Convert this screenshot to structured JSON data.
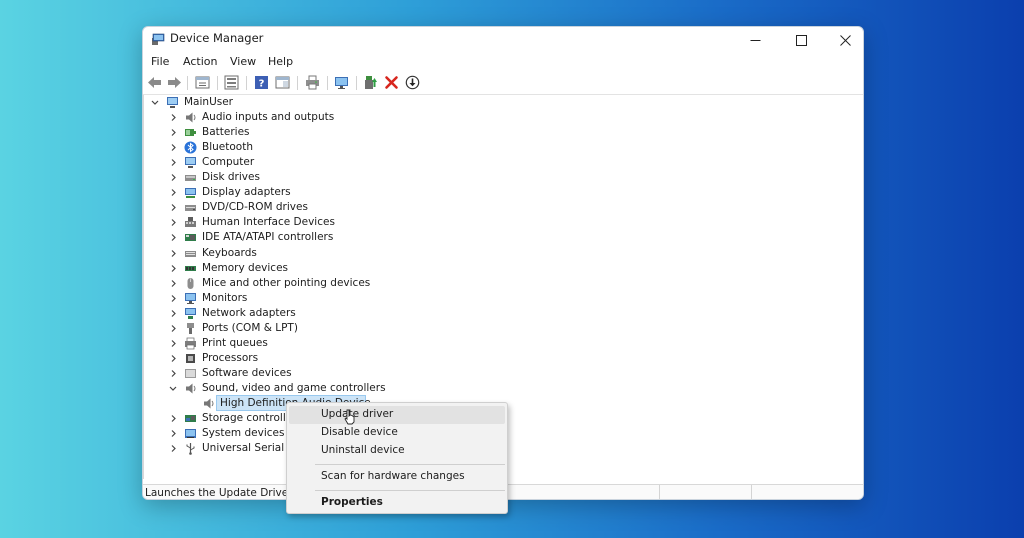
{
  "window": {
    "title": "Device Manager",
    "controls": {
      "minimize_icon": "minimize-icon",
      "maximize_icon": "maximize-icon",
      "close_icon": "close-icon"
    }
  },
  "menu": [
    "File",
    "Action",
    "View",
    "Help"
  ],
  "toolbar": {
    "icons": [
      "back-arrow-icon",
      "forward-arrow-icon",
      "properties-grid-icon",
      "device-list-icon",
      "help-icon",
      "action-panel-icon",
      "print-icon",
      "monitor-icon",
      "update-driver-icon",
      "uninstall-x-icon",
      "download-circle-icon"
    ]
  },
  "tree": {
    "root": "MainUser",
    "categories": [
      {
        "label": "Audio inputs and outputs",
        "icon": "speaker-icon",
        "expanded": false
      },
      {
        "label": "Batteries",
        "icon": "battery-icon",
        "expanded": false
      },
      {
        "label": "Bluetooth",
        "icon": "bluetooth-icon",
        "expanded": false
      },
      {
        "label": "Computer",
        "icon": "computer-icon",
        "expanded": false
      },
      {
        "label": "Disk drives",
        "icon": "disk-drive-icon",
        "expanded": false
      },
      {
        "label": "Display adapters",
        "icon": "display-adapter-icon",
        "expanded": false
      },
      {
        "label": "DVD/CD-ROM drives",
        "icon": "dvd-drive-icon",
        "expanded": false
      },
      {
        "label": "Human Interface Devices",
        "icon": "hid-icon",
        "expanded": false
      },
      {
        "label": "IDE ATA/ATAPI controllers",
        "icon": "ide-controller-icon",
        "expanded": false
      },
      {
        "label": "Keyboards",
        "icon": "keyboard-icon",
        "expanded": false
      },
      {
        "label": "Memory devices",
        "icon": "memory-icon",
        "expanded": false
      },
      {
        "label": "Mice and other pointing devices",
        "icon": "mouse-icon",
        "expanded": false
      },
      {
        "label": "Monitors",
        "icon": "monitor-icon",
        "expanded": false
      },
      {
        "label": "Network adapters",
        "icon": "network-adapter-icon",
        "expanded": false
      },
      {
        "label": "Ports (COM & LPT)",
        "icon": "port-icon",
        "expanded": false
      },
      {
        "label": "Print queues",
        "icon": "printer-icon",
        "expanded": false
      },
      {
        "label": "Processors",
        "icon": "processor-icon",
        "expanded": false
      },
      {
        "label": "Software devices",
        "icon": "software-device-icon",
        "expanded": false
      },
      {
        "label": "Sound, video and game controllers",
        "icon": "speaker-icon",
        "expanded": true
      },
      {
        "label": "Storage controlle",
        "icon": "storage-controller-icon",
        "expanded": false
      },
      {
        "label": "System devices",
        "icon": "system-device-icon",
        "expanded": false
      },
      {
        "label": "Universal Serial Bu",
        "icon": "usb-icon",
        "expanded": false
      }
    ],
    "child": {
      "label": "High Definition Audio Device",
      "icon": "speaker-icon",
      "selected": true
    }
  },
  "context_menu": {
    "items": [
      "Update driver",
      "Disable device",
      "Uninstall device"
    ],
    "scan": "Scan for hardware changes",
    "properties": "Properties"
  },
  "status_bar": {
    "text": "Launches the Update Driver W"
  },
  "colors": {
    "selection": "#cce4f7",
    "selection_border": "#99c9ef",
    "error_red": "#d7261e"
  }
}
